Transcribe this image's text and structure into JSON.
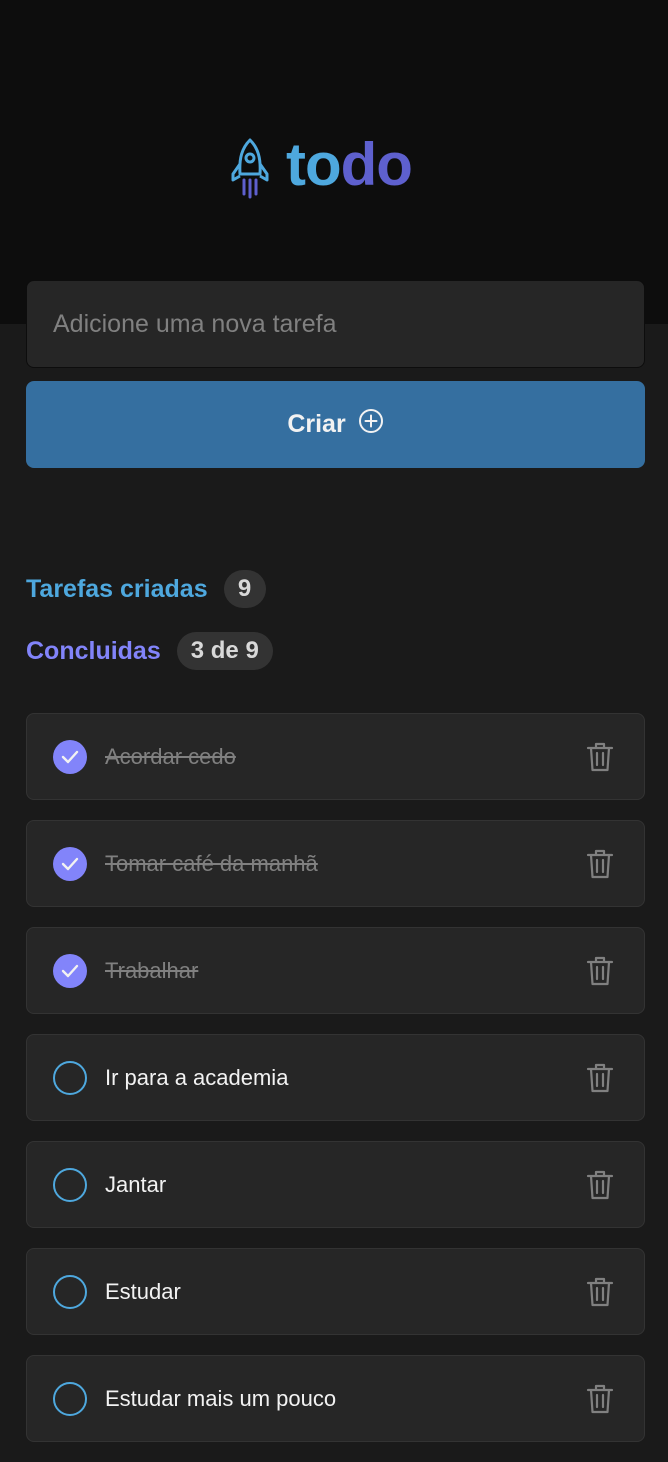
{
  "app": {
    "logo_part1": "to",
    "logo_part2": "do",
    "logo_icon": "rocket-icon"
  },
  "colors": {
    "header_bg": "#0d0d0d",
    "page_bg": "#1a1a1a",
    "blue": "#4ea8de",
    "purple": "#5e60ce",
    "purple_light": "#8284fa",
    "button_bg": "#356fa0",
    "card_bg": "#262626"
  },
  "new_task": {
    "placeholder": "Adicione uma nova tarefa",
    "value": ""
  },
  "create_button": {
    "label": "Criar",
    "icon": "plus-circle-icon"
  },
  "stats": {
    "created_label": "Tarefas criadas",
    "created_count": "9",
    "done_label": "Concluidas",
    "done_count": "3 de 9"
  },
  "tasks": [
    {
      "text": "Acordar cedo",
      "done": true
    },
    {
      "text": "Tomar café da manhã",
      "done": true
    },
    {
      "text": "Trabalhar",
      "done": true
    },
    {
      "text": "Ir para a academia",
      "done": false
    },
    {
      "text": "Jantar",
      "done": false
    },
    {
      "text": "Estudar",
      "done": false
    },
    {
      "text": "Estudar mais um pouco",
      "done": false
    }
  ],
  "task_icons": {
    "check": "check-icon",
    "delete": "trash-icon"
  }
}
